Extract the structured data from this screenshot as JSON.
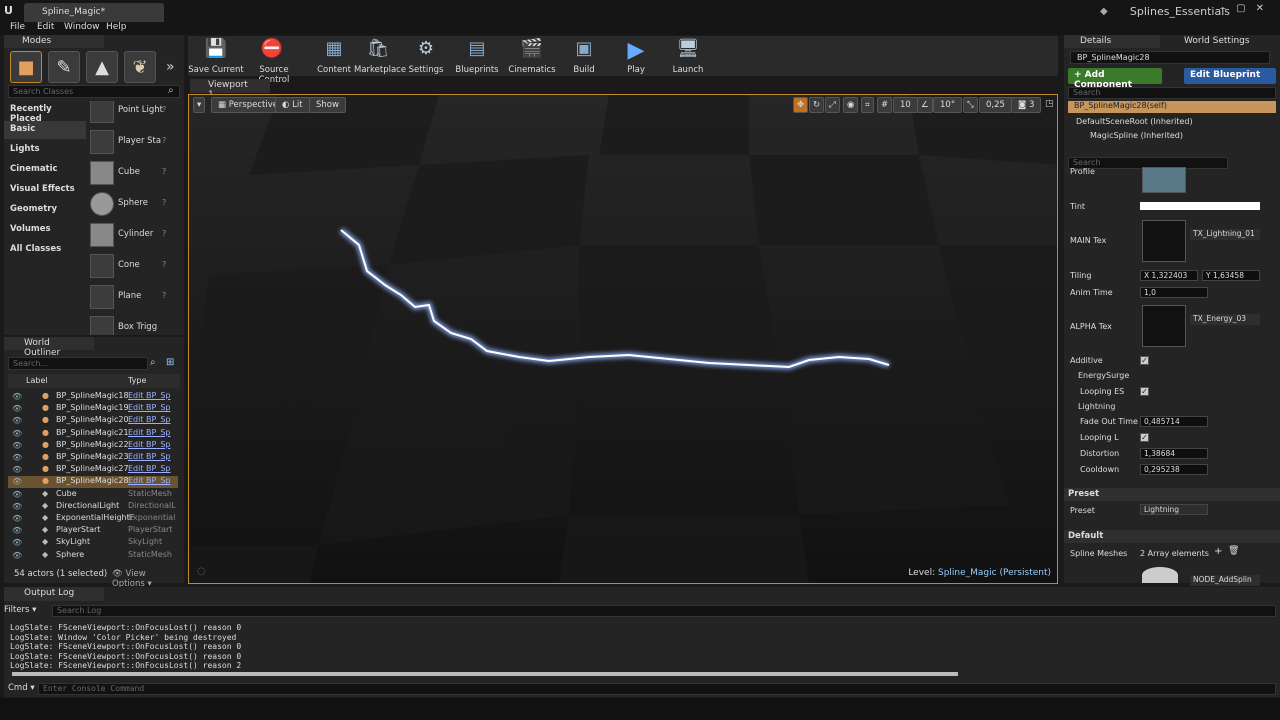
{
  "titlebar": {
    "doc_tab": "Spline_Magic*",
    "project": "Splines_Essentials"
  },
  "menu": [
    "File",
    "Edit",
    "Window",
    "Help"
  ],
  "modes": {
    "tab": "Modes",
    "search_placeholder": "Search Classes",
    "categories": [
      "Recently Placed",
      "Basic",
      "Lights",
      "Cinematic",
      "Visual Effects",
      "Geometry",
      "Volumes",
      "All Classes"
    ],
    "selected_category": "Basic",
    "classes": [
      "Point Light",
      "Player Sta",
      "Cube",
      "Sphere",
      "Cylinder",
      "Cone",
      "Plane",
      "Box Trigg"
    ]
  },
  "outliner": {
    "tab": "World Outliner",
    "search_placeholder": "Search...",
    "col_label": "Label",
    "col_type": "Type",
    "rows": [
      {
        "label": "BP_SplineMagic18",
        "type": "Edit BP_Sp",
        "link": true
      },
      {
        "label": "BP_SplineMagic19",
        "type": "Edit BP_Sp",
        "link": true
      },
      {
        "label": "BP_SplineMagic20",
        "type": "Edit BP_Sp",
        "link": true
      },
      {
        "label": "BP_SplineMagic21",
        "type": "Edit BP_Sp",
        "link": true
      },
      {
        "label": "BP_SplineMagic22",
        "type": "Edit BP_Sp",
        "link": true
      },
      {
        "label": "BP_SplineMagic23",
        "type": "Edit BP_Sp",
        "link": true
      },
      {
        "label": "BP_SplineMagic27",
        "type": "Edit BP_Sp",
        "link": true
      },
      {
        "label": "BP_SplineMagic28",
        "type": "Edit BP_Sp",
        "link": true
      },
      {
        "label": "Cube",
        "type": "StaticMesh",
        "link": false
      },
      {
        "label": "DirectionalLight",
        "type": "DirectionalL",
        "link": false
      },
      {
        "label": "ExponentialHeightF",
        "type": "Exponential",
        "link": false
      },
      {
        "label": "PlayerStart",
        "type": "PlayerStart",
        "link": false
      },
      {
        "label": "SkyLight",
        "type": "SkyLight",
        "link": false
      },
      {
        "label": "Sphere",
        "type": "StaticMesh",
        "link": false
      }
    ],
    "selected_row": 7,
    "footer": "54 actors (1 selected)",
    "view_options": "View Options"
  },
  "toolbar": [
    "Save Current",
    "Source Control",
    "Content",
    "Marketplace",
    "Settings",
    "Blueprints",
    "Cinematics",
    "Build",
    "Play",
    "Launch"
  ],
  "viewport": {
    "tab": "Viewport 1",
    "perspective": "Perspective",
    "lit": "Lit",
    "show": "Show",
    "grid": "10",
    "angle": "10°",
    "scale": "0,25",
    "cam_speed": "3",
    "level_label": "Level:",
    "level_name": "Spline_Magic (Persistent)"
  },
  "details": {
    "tab_details": "Details",
    "tab_world": "World Settings",
    "name": "BP_SplineMagic28",
    "add_component": "+ Add Component",
    "edit_blueprint": "Edit Blueprint",
    "comp_search": "Search",
    "self": "BP_SplineMagic28(self)",
    "components": [
      "DefaultSceneRoot (Inherited)",
      "MagicSpline (Inherited)"
    ],
    "search": "Search",
    "profile": "Profile",
    "tint": "Tint",
    "main_tex": "MAIN Tex",
    "main_tex_name": "TX_Lightning_01",
    "tiling": "Tiling",
    "tiling_x": "X  1,322403",
    "tiling_y": "Y  1,63458",
    "anim_time": "Anim Time",
    "anim_time_val": "1,0",
    "alpha_tex": "ALPHA Tex",
    "alpha_tex_name": "TX_Energy_03",
    "additive": "Additive",
    "energy_surge": "EnergySurge",
    "looping_es": "Looping ES",
    "lightning": "Lightning",
    "fade_out": "Fade Out Time",
    "fade_out_val": "0,485714",
    "looping_l": "Looping L",
    "distortion": "Distortion",
    "distortion_val": "1,38684",
    "cooldown": "Cooldown",
    "cooldown_val": "0,295238",
    "preset_section": "Preset",
    "preset_label": "Preset",
    "preset_val": "Lightning",
    "default_section": "Default",
    "spline_meshes": "Spline Meshes",
    "spline_meshes_val": "2 Array elements",
    "node": "NODE_AddSplin"
  },
  "output_log": {
    "tab": "Output Log",
    "filters": "Filters",
    "search_placeholder": "Search Log",
    "lines": [
      "LogSlate: FSceneViewport::OnFocusLost() reason 0",
      "LogSlate: Window 'Color Picker' being destroyed",
      "LogSlate: FSceneViewport::OnFocusLost() reason 0",
      "LogSlate: FSceneViewport::OnFocusLost() reason 0",
      "LogSlate: FSceneViewport::OnFocusLost() reason 2"
    ],
    "cmd": "Cmd",
    "cmd_placeholder": "Enter Console Command"
  },
  "icons": {
    "save": "save-icon",
    "source_control": "source-control-icon",
    "content": "content-icon",
    "marketplace": "marketplace-icon",
    "settings": "settings-icon",
    "blueprints": "blueprints-icon",
    "cinematics": "cinematics-icon",
    "build": "build-icon",
    "play": "play-icon",
    "launch": "launch-icon"
  }
}
